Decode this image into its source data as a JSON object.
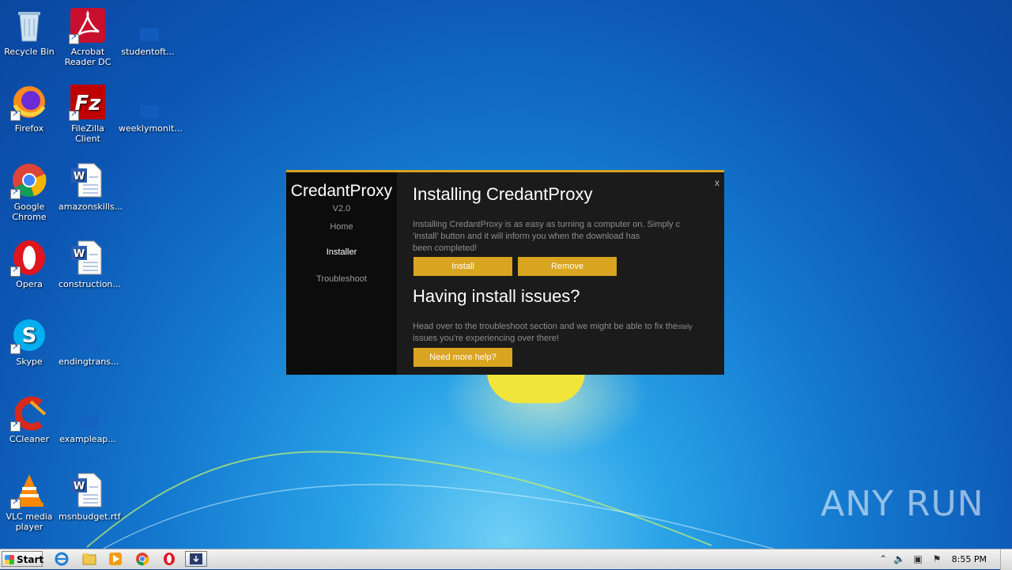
{
  "desktop": {
    "icons": [
      {
        "label": "Recycle Bin",
        "icon": "recycle-bin-icon"
      },
      {
        "label": "Acrobat Reader DC",
        "icon": "acrobat-icon"
      },
      {
        "label": "studentoft...",
        "icon": "file-icon"
      },
      {
        "label": "Firefox",
        "icon": "firefox-icon"
      },
      {
        "label": "FileZilla Client",
        "icon": "filezilla-icon"
      },
      {
        "label": "weeklymonit...",
        "icon": "file-icon"
      },
      {
        "label": "Google Chrome",
        "icon": "chrome-icon"
      },
      {
        "label": "amazonskills...",
        "icon": "word-doc-icon"
      },
      {
        "label": "Opera",
        "icon": "opera-icon"
      },
      {
        "label": "construction...",
        "icon": "word-doc-icon"
      },
      {
        "label": "Skype",
        "icon": "skype-icon"
      },
      {
        "label": "endingtrans...",
        "icon": "file-icon"
      },
      {
        "label": "CCleaner",
        "icon": "ccleaner-icon"
      },
      {
        "label": "exampleap...",
        "icon": "file-icon"
      },
      {
        "label": "VLC media player",
        "icon": "vlc-icon"
      },
      {
        "label": "msnbudget.rtf",
        "icon": "word-doc-icon"
      }
    ]
  },
  "dialog": {
    "app_name": "CredantProxy",
    "version": "V2.0",
    "close_label": "x",
    "nav": [
      "Home",
      "Installer",
      "Troubleshoot"
    ],
    "active_nav": "Installer",
    "install_heading": "Installing CredantProxy",
    "install_text_1": "Installing CredantProxy is as easy as turning a computer on. Simply c",
    "install_text_2": "'install' button and it will inform you when the download has",
    "install_text_3": "been completed!",
    "install_button": "Install",
    "remove_button": "Remove",
    "issues_heading": "Having install issues?",
    "issues_text_1": "Head over to the troubleshoot section and we might be able to fix the",
    "issues_text_overflow": "stely",
    "issues_text_2": "issues you're experiencing over there!",
    "help_button": "Need more help?",
    "accent_color": "#d9a521"
  },
  "taskbar": {
    "start_label": "Start",
    "clock": "8:55 PM",
    "apps": [
      "internet-explorer-icon",
      "explorer-folder-icon",
      "media-player-icon",
      "chrome-icon",
      "opera-icon",
      "credantproxy-app-icon"
    ]
  },
  "watermark": "ANY RUN"
}
